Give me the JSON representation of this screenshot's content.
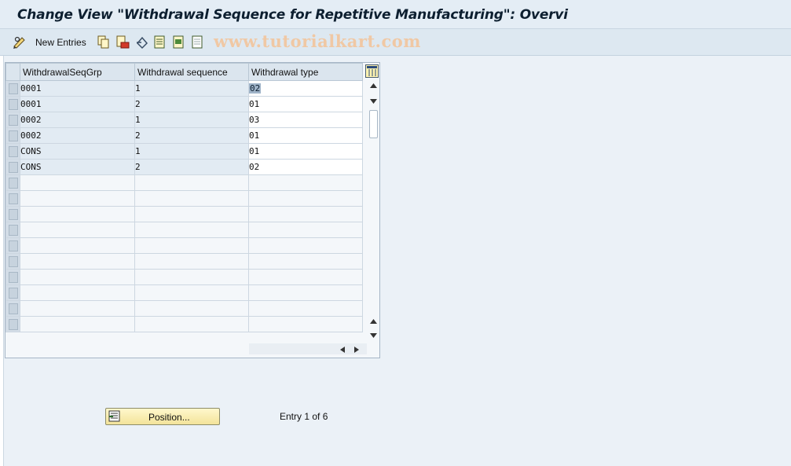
{
  "window": {
    "title": "Change View \"Withdrawal Sequence for Repetitive Manufacturing\": Overvi"
  },
  "toolbar": {
    "new_entries_label": "New Entries",
    "icons": [
      "edit-glasses-icon",
      "copy-icon",
      "delete-icon",
      "undo-icon",
      "select-all-icon",
      "select-block-icon",
      "deselect-all-icon"
    ]
  },
  "watermark": "www.tutorialkart.com",
  "table": {
    "columns": [
      "WithdrawalSeqGrp",
      "Withdrawal sequence",
      "Withdrawal type"
    ],
    "rows": [
      [
        "0001",
        "1",
        "02"
      ],
      [
        "0001",
        "2",
        "01"
      ],
      [
        "0002",
        "1",
        "03"
      ],
      [
        "0002",
        "2",
        "01"
      ],
      [
        "CONS",
        "1",
        "01"
      ],
      [
        "CONS",
        "2",
        "02"
      ]
    ],
    "empty_rows": 10
  },
  "footer": {
    "position_label": "Position...",
    "entry_info": "Entry 1 of 6"
  },
  "colors": {
    "title_bg": "#e4edf5",
    "toolbar_bg": "#dde8f1",
    "key_cell_bg": "#e2ebf3",
    "button_bg": "#f3e39a"
  }
}
